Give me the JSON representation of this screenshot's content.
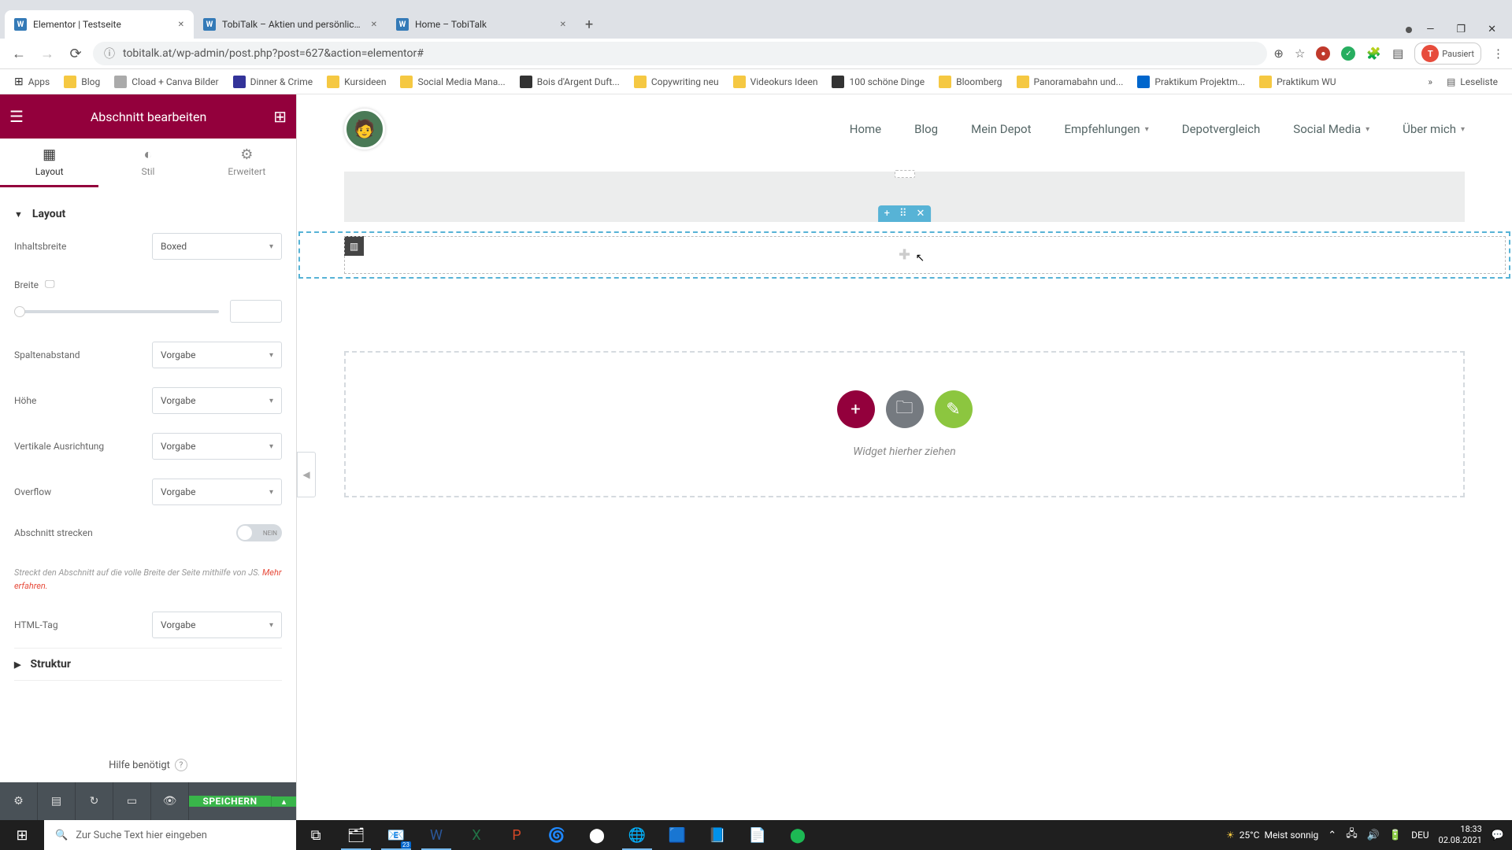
{
  "browser": {
    "tabs": [
      {
        "title": "Elementor | Testseite",
        "icon": "W",
        "active": true
      },
      {
        "title": "TobiTalk – Aktien und persönlich...",
        "icon": "W"
      },
      {
        "title": "Home – TobiTalk",
        "icon": "W"
      }
    ],
    "url": "tobitalk.at/wp-admin/post.php?post=627&action=elementor#",
    "pause": "Pausiert",
    "avatarLetter": "T",
    "readlist": "Leseliste"
  },
  "bookmarks": {
    "apps": "Apps",
    "items": [
      "Blog",
      "Cload + Canva Bilder",
      "Dinner & Crime",
      "Kursideen",
      "Social Media Mana...",
      "Bois d'Argent Duft...",
      "Copywriting neu",
      "Videokurs Ideen",
      "100 schöne Dinge",
      "Bloomberg",
      "Panoramabahn und...",
      "Praktikum Projektm...",
      "Praktikum WU"
    ]
  },
  "sidebar": {
    "title": "Abschnitt bearbeiten",
    "tabs": {
      "layout": "Layout",
      "stil": "Stil",
      "erw": "Erweitert"
    },
    "section": {
      "layout": "Layout",
      "struktur": "Struktur"
    },
    "labels": {
      "inhaltsbreite": "Inhaltsbreite",
      "breite": "Breite",
      "spaltenabstand": "Spaltenabstand",
      "hoehe": "Höhe",
      "vert": "Vertikale Ausrichtung",
      "overflow": "Overflow",
      "strecken": "Abschnitt strecken",
      "htmltag": "HTML-Tag"
    },
    "values": {
      "boxed": "Boxed",
      "vorgabe": "Vorgabe",
      "toggle": "NEIN"
    },
    "hint": "Streckt den Abschnitt auf die volle Breite der Seite mithilfe von JS. ",
    "hintLink": "Mehr erfahren.",
    "help": "Hilfe benötigt",
    "save": "SPEICHERN"
  },
  "nav": {
    "items": [
      "Home",
      "Blog",
      "Mein Depot",
      "Empfehlungen",
      "Depotvergleich",
      "Social Media",
      "Über mich"
    ],
    "dropdowns": [
      3,
      5,
      6
    ]
  },
  "canvas": {
    "dropText": "Widget hierher ziehen"
  },
  "taskbar": {
    "searchPlaceholder": "Zur Suche Text hier eingeben",
    "temp": "25°C",
    "weather": "Meist sonnig",
    "lang": "DEU",
    "time": "18:33",
    "date": "02.08.2021",
    "badge23": "23"
  }
}
